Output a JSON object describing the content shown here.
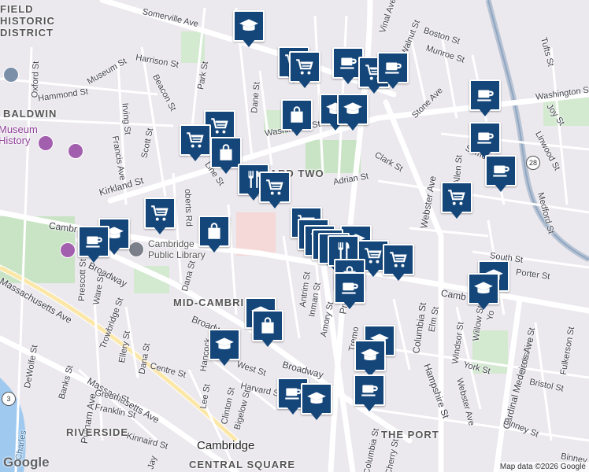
{
  "map": {
    "streets": [
      {
        "id": "somerville-ave-w",
        "text": "Somerville Ave"
      },
      {
        "id": "vinal-ave",
        "text": "Vinal Ave"
      },
      {
        "id": "walnut-st",
        "text": "Walnut St"
      },
      {
        "id": "boston-st",
        "text": "Boston St"
      },
      {
        "id": "munroe-st",
        "text": "Munroe St"
      },
      {
        "id": "tufts-st",
        "text": "Tufts St"
      },
      {
        "id": "harrison-st",
        "text": "Harrison St"
      },
      {
        "id": "park-st",
        "text": "Park St"
      },
      {
        "id": "museum-st",
        "text": "Museum St"
      },
      {
        "id": "oxford-st",
        "text": "Oxford St"
      },
      {
        "id": "hammond-st",
        "text": "Hammond St"
      },
      {
        "id": "beacon-st",
        "text": "Beacon St"
      },
      {
        "id": "dane-st",
        "text": "Dane St"
      },
      {
        "id": "washington-st-e",
        "text": "Washington St"
      },
      {
        "id": "joy-st",
        "text": "Joy St"
      },
      {
        "id": "stone-ave",
        "text": "Stone Ave"
      },
      {
        "id": "irving-st",
        "text": "Irving St"
      },
      {
        "id": "scott-st",
        "text": "Scott St"
      },
      {
        "id": "washington-st",
        "text": "Washington St"
      },
      {
        "id": "francis-ave",
        "text": "Francis Ave"
      },
      {
        "id": "linwood-st",
        "text": "Linwood St"
      },
      {
        "id": "somerville-ave-e",
        "text": "Some"
      },
      {
        "id": "clark-st",
        "text": "Clark St"
      },
      {
        "id": "kirkland-st",
        "text": "Kirkland St"
      },
      {
        "id": "line-st",
        "text": "Line St"
      },
      {
        "id": "webster-ave",
        "text": "Webster Ave"
      },
      {
        "id": "allen-st",
        "text": "Allen St"
      },
      {
        "id": "adrian-st",
        "text": "Adrian St"
      },
      {
        "id": "medford-st",
        "text": "Medford St"
      },
      {
        "id": "roberts-rd",
        "text": "oberts Rd"
      },
      {
        "id": "cambridge-st-w",
        "text": "Cambr"
      },
      {
        "id": "broadway-w",
        "text": "Broadway"
      },
      {
        "id": "prescott-st",
        "text": "Prescott St"
      },
      {
        "id": "ware-st",
        "text": "Ware St"
      },
      {
        "id": "dana-st",
        "text": "Dana St"
      },
      {
        "id": "south-st",
        "text": "South St"
      },
      {
        "id": "porter-st",
        "text": "Porter St"
      },
      {
        "id": "massachusetts-ave-w",
        "text": "Massachusetts Ave"
      },
      {
        "id": "trowbridge-st",
        "text": "Trowbridge St"
      },
      {
        "id": "antrim-st",
        "text": "Antrim St"
      },
      {
        "id": "inman-st",
        "text": "Inman St"
      },
      {
        "id": "amory-st",
        "text": "Amory St"
      },
      {
        "id": "prospect-st",
        "text": "Pros"
      },
      {
        "id": "columbia-st-n",
        "text": "Columbia St"
      },
      {
        "id": "elm-st",
        "text": "Elm St"
      },
      {
        "id": "cambridge-st-e",
        "text": "Camb"
      },
      {
        "id": "windsor-st",
        "text": "Windsor St"
      },
      {
        "id": "willow-st",
        "text": "Willow St"
      },
      {
        "id": "berkshire-st",
        "text": "Berkshire St"
      },
      {
        "id": "cardinal-medeiros",
        "text": "Cardinal Medeiros Ave"
      },
      {
        "id": "fulkerson-st",
        "text": "Fulkerson St"
      },
      {
        "id": "broadway-mid",
        "text": "Broadway"
      },
      {
        "id": "ellery-st",
        "text": "Ellery St"
      },
      {
        "id": "dana-st-s",
        "text": "Dana St"
      },
      {
        "id": "centre-st",
        "text": "Centre St"
      },
      {
        "id": "hancock-st",
        "text": "Hancock"
      },
      {
        "id": "west-st",
        "text": "West St"
      },
      {
        "id": "tremont-st",
        "text": "Tremo"
      },
      {
        "id": "york-st",
        "text": "York St"
      },
      {
        "id": "bristol-st",
        "text": "Bristol St"
      },
      {
        "id": "dewolfe-st",
        "text": "DeWolfe St"
      },
      {
        "id": "banks-st",
        "text": "Banks St"
      },
      {
        "id": "massachusetts-ave-s",
        "text": "Massachusetts Ave"
      },
      {
        "id": "harvard-st",
        "text": "Harvard St"
      },
      {
        "id": "broadway-s",
        "text": "Broadway"
      },
      {
        "id": "hampshire-st",
        "text": "Hampshire St"
      },
      {
        "id": "webster-ave-s",
        "text": "Webster Ave"
      },
      {
        "id": "green-st",
        "text": "Green St"
      },
      {
        "id": "lee-st",
        "text": "Lee St"
      },
      {
        "id": "clinton-st",
        "text": "Clinton St"
      },
      {
        "id": "putnam-ave",
        "text": "Putnam Ave"
      },
      {
        "id": "franklin-st",
        "text": "Franklin St"
      },
      {
        "id": "bigelow-st",
        "text": "Bigelow St"
      },
      {
        "id": "binney-st",
        "text": "Binney St"
      },
      {
        "id": "binney-st-e",
        "text": "Binney"
      },
      {
        "id": "kinnaird-st",
        "text": "Kinnaird St"
      },
      {
        "id": "columbia-st-s",
        "text": "Columbia St"
      },
      {
        "id": "cherry-st",
        "text": "Cherry St"
      },
      {
        "id": "jay-st",
        "text": "Jay"
      },
      {
        "id": "yo-st",
        "text": "Yo"
      }
    ],
    "neighborhoods": [
      {
        "id": "historic-district",
        "lines": [
          "FIELD",
          "HISTORIC",
          "DISTRICT"
        ]
      },
      {
        "id": "baldwin",
        "text": "BALDWIN"
      },
      {
        "id": "ward-two",
        "text": "WARD TWO"
      },
      {
        "id": "mid-cambridge",
        "text": "MID-CAMBRIDGE"
      },
      {
        "id": "riverside",
        "text": "RIVERSIDE"
      },
      {
        "id": "the-port",
        "text": "THE PORT"
      },
      {
        "id": "central-square",
        "text": "CENTRAL SQUARE"
      }
    ],
    "city_label": "Cambridge",
    "pois": [
      {
        "id": "museum-history",
        "lines": [
          "Museum",
          "History"
        ]
      },
      {
        "id": "cambridge-public-library",
        "lines": [
          "Cambridge",
          "Public Library"
        ]
      }
    ],
    "river_label": "Charles",
    "route_shields": [
      {
        "id": "route-28",
        "text": "28"
      },
      {
        "id": "route-3",
        "text": "3"
      }
    ],
    "attribution": "Map data ©2026 Google",
    "google_logo": "Google",
    "markers": [
      {
        "type": "school"
      },
      {
        "type": "cart"
      },
      {
        "type": "cart"
      },
      {
        "type": "coffee"
      },
      {
        "type": "cart"
      },
      {
        "type": "coffee"
      },
      {
        "type": "coffee"
      },
      {
        "type": "bag"
      },
      {
        "type": "school"
      },
      {
        "type": "school"
      },
      {
        "type": "cart"
      },
      {
        "type": "cart"
      },
      {
        "type": "bag"
      },
      {
        "type": "coffee"
      },
      {
        "type": "restaurant"
      },
      {
        "type": "cart"
      },
      {
        "type": "coffee"
      },
      {
        "type": "cart"
      },
      {
        "type": "cart"
      },
      {
        "type": "bag"
      },
      {
        "type": "school"
      },
      {
        "type": "coffee"
      },
      {
        "type": "school"
      },
      {
        "type": "cart"
      },
      {
        "type": "cart"
      },
      {
        "type": "cart"
      },
      {
        "type": "restaurant"
      },
      {
        "type": "restaurant"
      },
      {
        "type": "restaurant"
      },
      {
        "type": "cart"
      },
      {
        "type": "cart"
      },
      {
        "type": "bag"
      },
      {
        "type": "coffee"
      },
      {
        "type": "school"
      },
      {
        "type": "school"
      },
      {
        "type": "school"
      },
      {
        "type": "bag"
      },
      {
        "type": "school"
      },
      {
        "type": "school"
      },
      {
        "type": "school"
      },
      {
        "type": "coffee"
      },
      {
        "type": "coffee"
      },
      {
        "type": "school"
      }
    ]
  }
}
